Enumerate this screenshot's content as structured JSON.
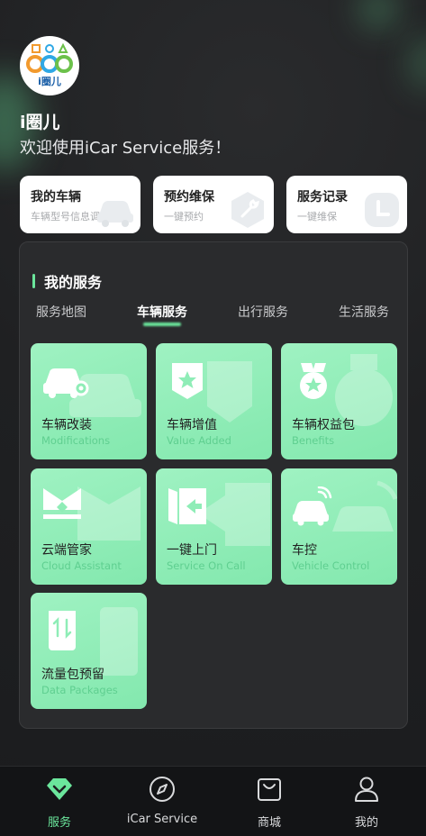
{
  "header": {
    "brand_name": "i圈儿",
    "welcome": "欢迎使用iCar Service服务！",
    "logo_text": "i圈儿"
  },
  "quick_cards": [
    {
      "title": "我的车辆",
      "subtitle": "车辆型号信息调取",
      "icon": "car-icon"
    },
    {
      "title": "预约维保",
      "subtitle": "一键预约",
      "icon": "wrench-icon"
    },
    {
      "title": "服务记录",
      "subtitle": "一键维保",
      "icon": "clock-icon"
    }
  ],
  "services": {
    "title": "我的服务",
    "tabs": [
      "服务地图",
      "车辆服务",
      "出行服务",
      "生活服务"
    ],
    "active_tab": "车辆服务",
    "tiles": [
      {
        "title": "车辆改装",
        "subtitle": "Modifications",
        "icon": "car-gear-icon"
      },
      {
        "title": "车辆增值",
        "subtitle": "Value Added",
        "icon": "star-badge-icon"
      },
      {
        "title": "车辆权益包",
        "subtitle": "Benefits",
        "icon": "medal-icon"
      },
      {
        "title": "云端管家",
        "subtitle": "Cloud Assistant",
        "icon": "cloud-butler-icon"
      },
      {
        "title": "一键上门",
        "subtitle": "Service On Call",
        "icon": "door-arrow-icon"
      },
      {
        "title": "车控",
        "subtitle": "Vehicle Control",
        "icon": "remote-car-icon"
      },
      {
        "title": "流量包预留",
        "subtitle": "Data Packages",
        "icon": "data-transfer-icon"
      }
    ]
  },
  "bottom_nav": [
    {
      "label": "服务",
      "icon": "diamond-check-icon",
      "active": true
    },
    {
      "label": "iCar Service",
      "icon": "compass-icon",
      "active": false
    },
    {
      "label": "商城",
      "icon": "shopping-bag-icon",
      "active": false
    },
    {
      "label": "我的",
      "icon": "user-icon",
      "active": false
    }
  ],
  "colors": {
    "accent": "#6be69c",
    "tile_bg": "#8fedb7",
    "background": "#1e1f21",
    "panel": "#2a2b2d"
  }
}
